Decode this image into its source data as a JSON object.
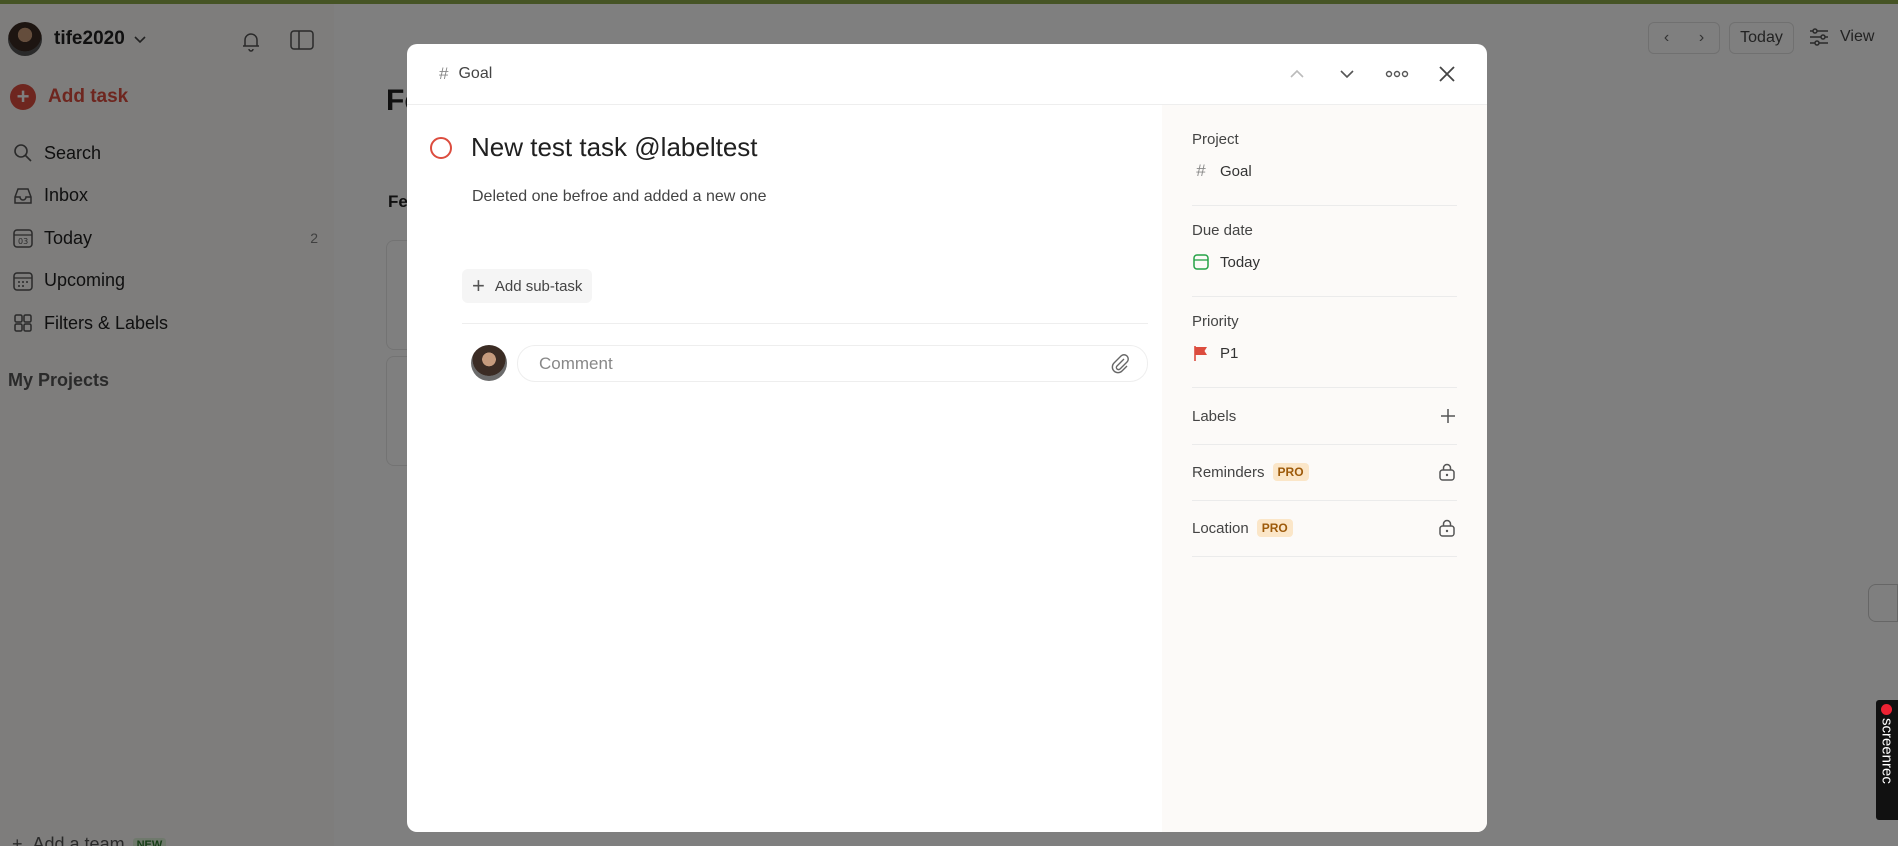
{
  "user": {
    "name": "tife2020"
  },
  "sidebar": {
    "add_task_label": "Add task",
    "items": [
      {
        "label": "Search",
        "icon": "search-icon",
        "count": ""
      },
      {
        "label": "Inbox",
        "icon": "inbox-icon",
        "count": ""
      },
      {
        "label": "Today",
        "icon": "calendar-today-icon",
        "count": "2"
      },
      {
        "label": "Upcoming",
        "icon": "calendar-grid-icon",
        "count": ""
      },
      {
        "label": "Filters & Labels",
        "icon": "grid-icon",
        "count": ""
      }
    ],
    "my_projects_label": "My Projects",
    "add_team_label": "Add a team",
    "add_team_badge": "NEW"
  },
  "main": {
    "title": "Fe",
    "subheading": "Fe",
    "today_button": "Today",
    "view_button": "View"
  },
  "modal": {
    "breadcrumb_project": "Goal",
    "task_title": "New test task @labeltest",
    "task_description": "Deleted one befroe and added a new one",
    "add_subtask_label": "Add sub-task",
    "comment_placeholder": "Comment",
    "properties": {
      "project_label": "Project",
      "project_value": "Goal",
      "due_date_label": "Due date",
      "due_date_value": "Today",
      "priority_label": "Priority",
      "priority_value": "P1",
      "labels_label": "Labels",
      "reminders_label": "Reminders",
      "location_label": "Location",
      "pro_badge": "PRO"
    }
  },
  "screenrec": {
    "label": "screenrec"
  },
  "colors": {
    "accent_red": "#dc4c3e",
    "due_date_green": "#25a146",
    "pro_badge_bg": "#fbe6c8",
    "top_bar_green": "#8da94a"
  }
}
